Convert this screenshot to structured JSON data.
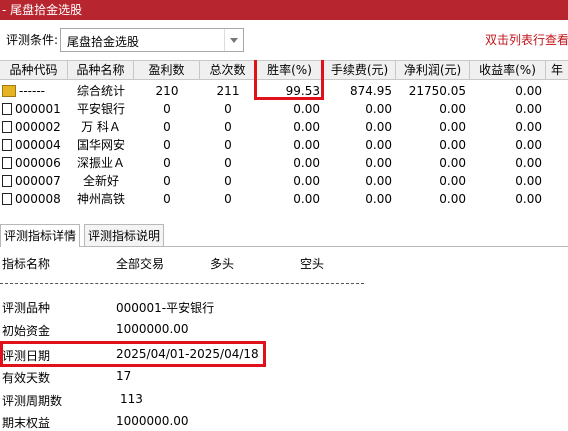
{
  "window": {
    "title": "- 尾盘拾金选股"
  },
  "condition": {
    "label": "评测条件:",
    "value": "尾盘拾金选股",
    "hint": "双击列表行查看"
  },
  "table": {
    "columns": [
      "品种代码",
      "品种名称",
      "盈利数",
      "总次数",
      "胜率(%)",
      "手续费(元)",
      "净利润(元)",
      "收益率(%)",
      "年"
    ],
    "rows": [
      {
        "code": "------",
        "name": "综合统计",
        "profit": "210",
        "total": "211",
        "rate": "99.53",
        "fee": "874.95",
        "net": "21750.05",
        "yield": "0.00"
      },
      {
        "code": "000001",
        "name": "平安银行",
        "profit": "0",
        "total": "0",
        "rate": "0.00",
        "fee": "0.00",
        "net": "0.00",
        "yield": "0.00"
      },
      {
        "code": "000002",
        "name": "万 科Ａ",
        "profit": "0",
        "total": "0",
        "rate": "0.00",
        "fee": "0.00",
        "net": "0.00",
        "yield": "0.00"
      },
      {
        "code": "000004",
        "name": "国华网安",
        "profit": "0",
        "total": "0",
        "rate": "0.00",
        "fee": "0.00",
        "net": "0.00",
        "yield": "0.00"
      },
      {
        "code": "000006",
        "name": "深振业Ａ",
        "profit": "0",
        "total": "0",
        "rate": "0.00",
        "fee": "0.00",
        "net": "0.00",
        "yield": "0.00"
      },
      {
        "code": "000007",
        "name": "全新好",
        "profit": "0",
        "total": "0",
        "rate": "0.00",
        "fee": "0.00",
        "net": "0.00",
        "yield": "0.00"
      },
      {
        "code": "000008",
        "name": "神州高铁",
        "profit": "0",
        "total": "0",
        "rate": "0.00",
        "fee": "0.00",
        "net": "0.00",
        "yield": "0.00"
      }
    ]
  },
  "tabs": [
    "评测指标详情",
    "评测指标说明"
  ],
  "detail": {
    "headers": {
      "metric": "指标名称",
      "all": "全部交易",
      "long": "多头",
      "short": "空头"
    },
    "items": [
      {
        "label": "评测品种",
        "value": "000001-平安银行"
      },
      {
        "label": "初始资金",
        "value": "1000000.00"
      },
      {
        "label": "评测日期",
        "value": "2025/04/01-2025/04/18"
      },
      {
        "label": "有效天数",
        "value": "17"
      },
      {
        "label": "评测周期数",
        "value": "113"
      },
      {
        "label": "期末权益",
        "value": "1000000.00"
      }
    ]
  },
  "colors": {
    "title_bg": "#b7262f",
    "hint": "#c0141b",
    "highlight_border": "#e0111b"
  }
}
